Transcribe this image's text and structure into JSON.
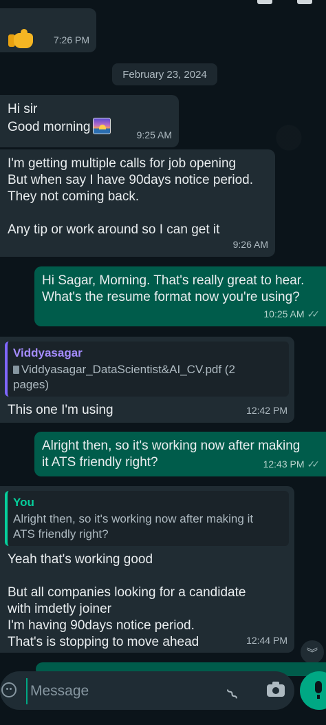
{
  "messages": [
    {
      "id": "m1",
      "direction": "in",
      "emoji": "thumbs-up-emoji",
      "time": "7:26 PM"
    },
    {
      "id": "m2",
      "direction": "in",
      "lines": [
        "Hi sir",
        "Good morning"
      ],
      "emoji": "sunrise-emoji",
      "time": "9:25 AM"
    },
    {
      "id": "m3",
      "direction": "in",
      "lines": [
        "I'm getting multiple calls for job opening",
        "But when say I have 90days notice period.",
        "They not coming back.",
        "",
        "Any tip or work around so I can get it"
      ],
      "time": "9:26 AM"
    },
    {
      "id": "m4",
      "direction": "out",
      "lines": [
        "Hi Sagar, Morning. That's really great to hear.",
        "What's the resume format now you're using?"
      ],
      "time": "10:25 AM"
    },
    {
      "id": "m5",
      "direction": "in",
      "quote": {
        "author": "Viddyasagar",
        "lines": [
          "Viddyasagar_DataScientist&AI_CV.pdf (2",
          "pages)"
        ]
      },
      "lines": [
        "This one I'm using"
      ],
      "time": "12:42 PM"
    },
    {
      "id": "m6",
      "direction": "out",
      "lines": [
        "Alright then, so it's working now after making",
        "it ATS friendly right?"
      ],
      "time": "12:43 PM"
    },
    {
      "id": "m7",
      "direction": "in",
      "quote": {
        "author": "You",
        "lines": [
          "Alright then, so it's working now after making it",
          "ATS friendly right?"
        ]
      },
      "lines": [
        "Yeah that's working good",
        "",
        "But all companies looking for a candidate",
        "with imdetly joiner",
        "I'm having 90days notice period.",
        "That's is stopping to move ahead"
      ],
      "time": "12:44 PM"
    }
  ],
  "date_divider": "February 23, 2024",
  "input": {
    "placeholder": "Message"
  },
  "icons": {
    "emoji": "emoji-icon",
    "attach": "paperclip-icon",
    "camera": "camera-icon",
    "mic": "mic-icon",
    "scroll_down": "double-chevron-down-icon",
    "read_receipt": "double-check-icon"
  },
  "colors": {
    "background": "#0b141a",
    "incoming": "#202c33",
    "outgoing": "#005c4b",
    "accent": "#00a884",
    "quote_author": "#a58cff"
  }
}
